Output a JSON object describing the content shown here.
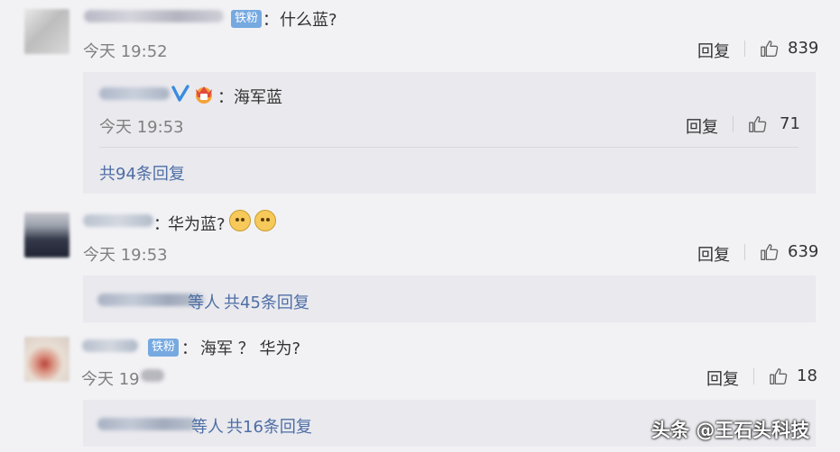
{
  "comments": [
    {
      "badge": "铁粉",
      "colon": "：",
      "text": "什么蓝?",
      "time": "今天 19:52",
      "reply_label": "回复",
      "like_count": "839",
      "replies": [
        {
          "colon": "：",
          "text": "海军蓝",
          "time": "今天 19:53",
          "reply_label": "回复",
          "like_count": "71"
        }
      ],
      "more_replies": "共94条回复"
    },
    {
      "colon": "：",
      "text": "华为蓝?",
      "time": "今天 19:53",
      "reply_label": "回复",
      "like_count": "639",
      "summary_suffix": "等人",
      "more_replies": "共45条回复"
    },
    {
      "badge": "铁粉",
      "colon": "：",
      "text": "海军 ？  华为?",
      "time": "今天 19",
      "reply_label": "回复",
      "like_count": "18",
      "summary_suffix": "等人",
      "more_replies": "共16条回复"
    }
  ],
  "watermark": "头条 @王石头科技",
  "icons": {
    "like": "thumbs-up-icon",
    "verified": "verified-v-icon",
    "vip": "crown-icon",
    "emoji": "doge-emoji-icon"
  },
  "colors": {
    "link": "#4e6ea5",
    "badge": "#76a9e0",
    "verified": "#3a8be0",
    "background": "#f2f2f5"
  }
}
